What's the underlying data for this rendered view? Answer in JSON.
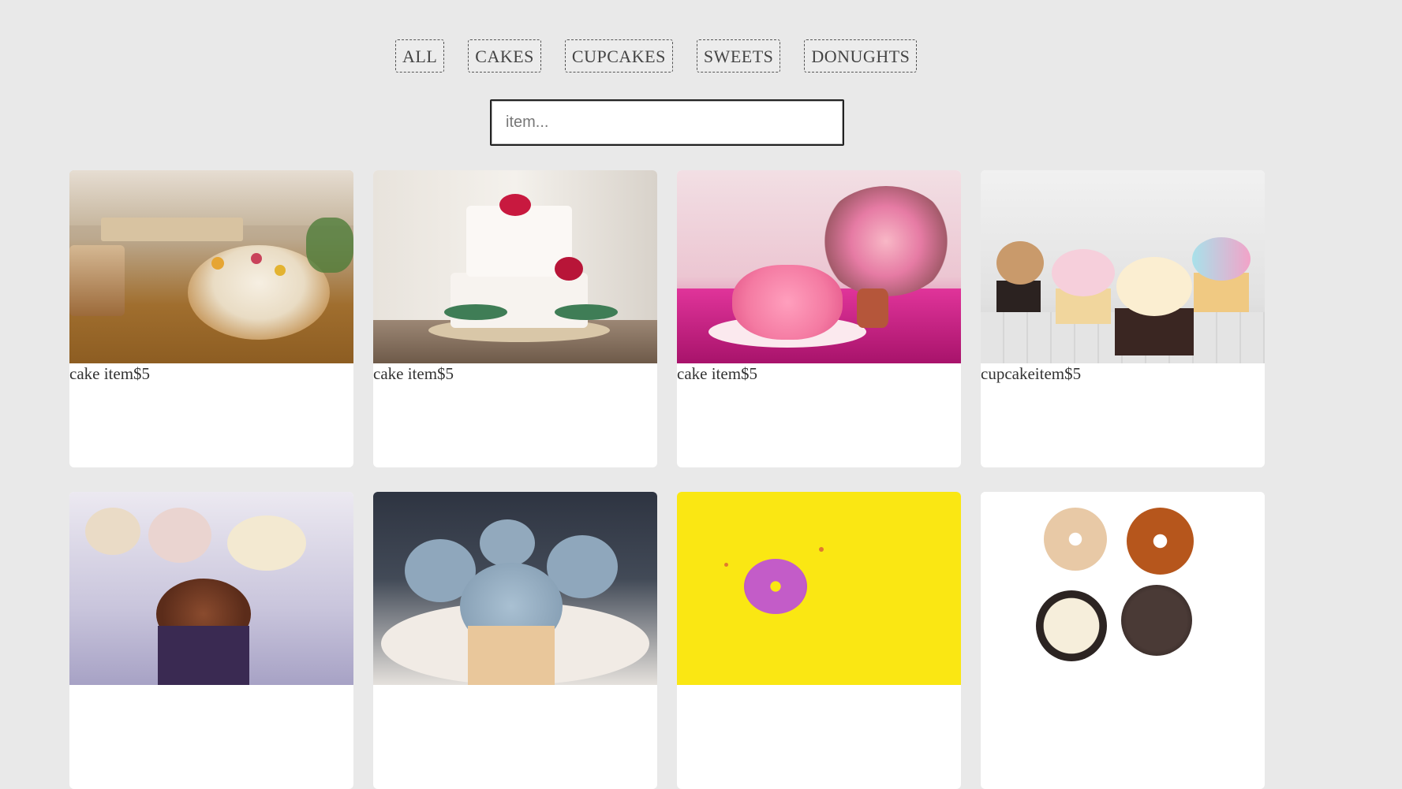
{
  "filters": [
    "ALL",
    "CAKES",
    "CUPCAKES",
    "SWEETS",
    "DONUGHTS"
  ],
  "search": {
    "placeholder": "item...",
    "value": ""
  },
  "items": [
    {
      "label": "cake item$5",
      "image": "naked-cake-with-flowers"
    },
    {
      "label": "cake item$5",
      "image": "two-tier-white-cake-with-red-flowers"
    },
    {
      "label": "cake item$5",
      "image": "pink-rosette-cake"
    },
    {
      "label": "cupcakeitem$5",
      "image": "assorted-cupcakes"
    },
    {
      "label": "",
      "image": "chocolate-frosted-cupcakes"
    },
    {
      "label": "",
      "image": "blue-frosted-cupcakes"
    },
    {
      "label": "",
      "image": "pink-donut-on-yellow"
    },
    {
      "label": "",
      "image": "four-donuts-on-white"
    }
  ],
  "colors": {
    "background": "#e9e9e9",
    "card": "#ffffff",
    "text": "#333333"
  }
}
